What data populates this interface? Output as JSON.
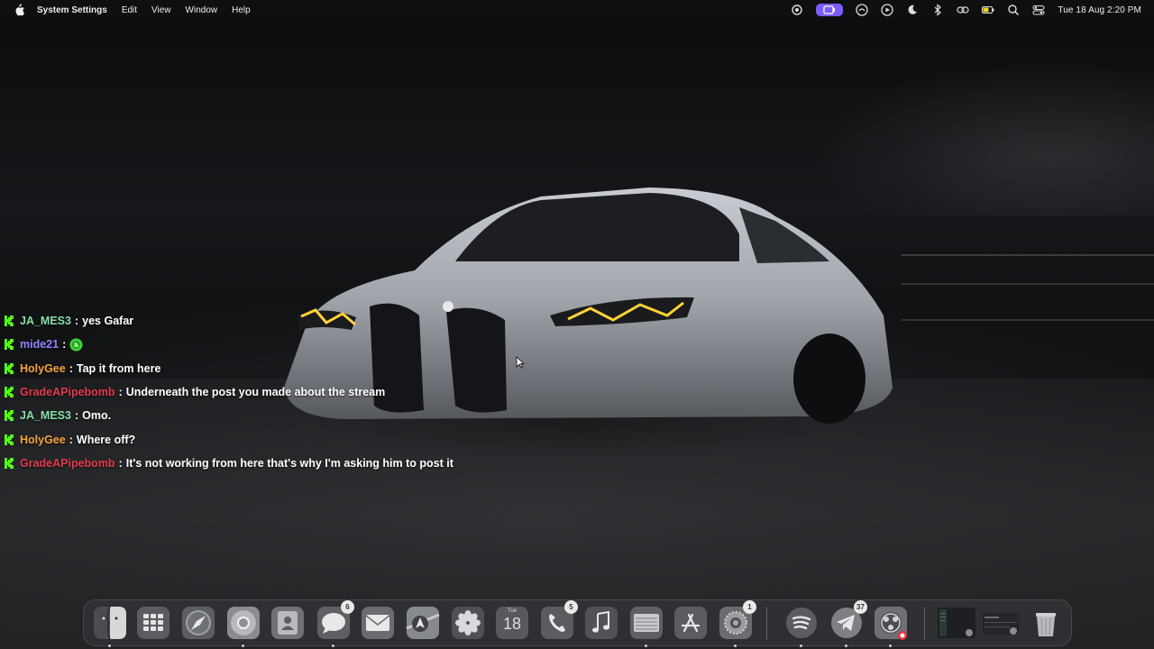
{
  "menubar": {
    "app_name": "System Settings",
    "menus": [
      "Edit",
      "View",
      "Window",
      "Help"
    ],
    "clock": "Tue 18 Aug  2:20 PM"
  },
  "chat": {
    "messages": [
      {
        "user": "JA_MES3",
        "user_color": "#86e0a6",
        "text": "yes Gafar",
        "emote": false
      },
      {
        "user": "mide21",
        "user_color": "#8f86ff",
        "text": "",
        "emote": true
      },
      {
        "user": "HolyGee",
        "user_color": "#f4a340",
        "text": "Tap it from here",
        "emote": false
      },
      {
        "user": "GradeAPipebomb",
        "user_color": "#e23a4e",
        "text": "Underneath the post you made about the stream",
        "emote": false
      },
      {
        "user": "JA_MES3",
        "user_color": "#86e0a6",
        "text": "Omo.",
        "emote": false
      },
      {
        "user": "HolyGee",
        "user_color": "#f4a340",
        "text": "Where off?",
        "emote": false
      },
      {
        "user": "GradeAPipebomb",
        "user_color": "#e23a4e",
        "text": "It's not working from here that's why I'm asking him to post it",
        "emote": false
      }
    ],
    "separator": ":"
  },
  "dock": {
    "badges": {
      "messages": "6",
      "phone": "5",
      "settings": "1",
      "telegram": "37"
    },
    "calendar": {
      "day_label": "Tue",
      "day_number": "18"
    }
  },
  "colors": {
    "kick_green": "#53fc18",
    "accent_purple": "#7a5cff"
  }
}
